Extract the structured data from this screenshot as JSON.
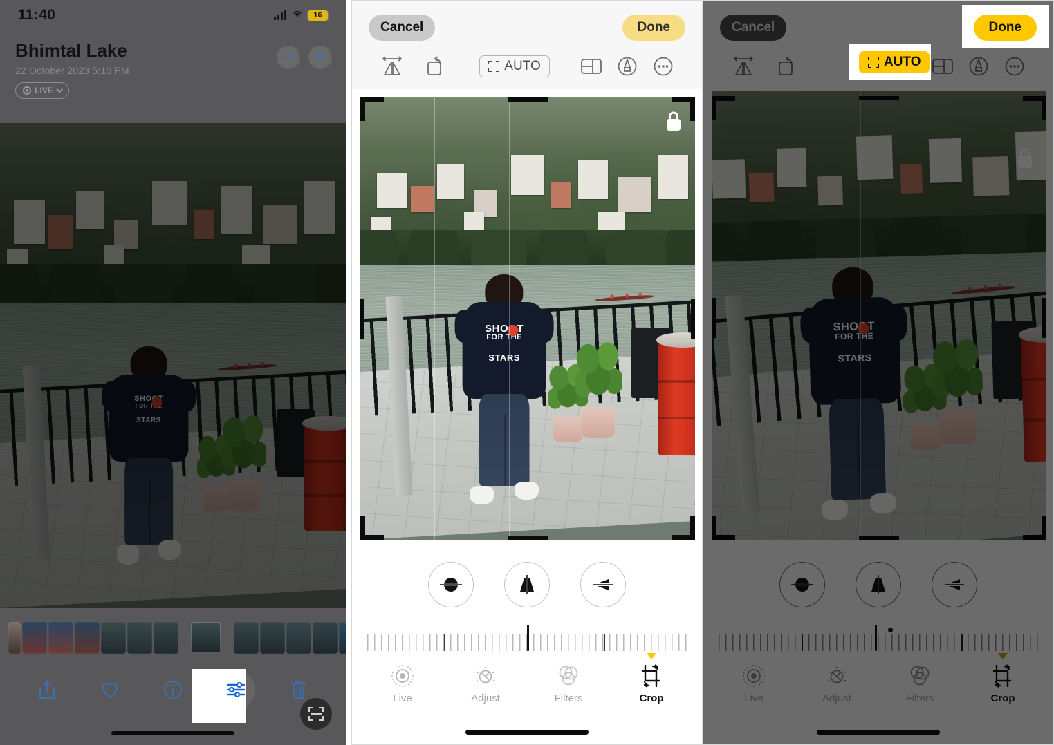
{
  "panel1": {
    "status_bar": {
      "time": "11:40",
      "battery_level": "16",
      "cellular_icon": "cellular-bars-icon",
      "wifi_icon": "wifi-icon",
      "battery_color": "#e0b714"
    },
    "photo_title": "Bhimtal Lake",
    "photo_meta": "22 October 2023  5:10 PM",
    "live_badge": {
      "label": "LIVE",
      "icon": "live-photo-icon",
      "chevron": "chevron-down-icon"
    },
    "header_buttons": [
      {
        "name": "more-options-button",
        "icon": "ellipsis-icon"
      },
      {
        "name": "close-button",
        "icon": "close-icon"
      }
    ],
    "scan_button_icon": "live-text-scan-icon",
    "toolbar": [
      {
        "label": "share",
        "icon": "share-icon",
        "highlighted": false
      },
      {
        "label": "favorite",
        "icon": "heart-icon",
        "highlighted": false
      },
      {
        "label": "info",
        "icon": "info-icon",
        "highlighted": false
      },
      {
        "label": "edit",
        "icon": "adjust-sliders-icon",
        "highlighted": true
      },
      {
        "label": "delete",
        "icon": "trash-icon",
        "highlighted": false
      }
    ],
    "accent_color": "#3f6ea8"
  },
  "panel2": {
    "cancel_label": "Cancel",
    "done_label": "Done",
    "tools": [
      {
        "name": "flip-horizontal-icon",
        "label": "Flip"
      },
      {
        "name": "rotate-icon",
        "label": "Rotate"
      },
      {
        "name": "auto-icon",
        "label": "AUTO",
        "active": false
      },
      {
        "name": "aspect-ratio-icon",
        "label": "Aspect Ratio"
      },
      {
        "name": "markup-pen-icon",
        "label": "Markup"
      },
      {
        "name": "more-ellipsis-icon",
        "label": "More"
      }
    ],
    "auto_label": "AUTO",
    "lock_icon": "aspect-lock-icon",
    "geometry_controls": [
      {
        "name": "straighten-icon",
        "label": "Straighten"
      },
      {
        "name": "vertical-perspective-icon",
        "label": "Vertical"
      },
      {
        "name": "horizontal-perspective-icon",
        "label": "Horizontal"
      }
    ],
    "ruler": {
      "needle_percent": 50,
      "major_tick_percents": [
        24,
        74
      ],
      "dot": false
    },
    "tabs": [
      {
        "label": "Live",
        "icon": "live-photo-icon",
        "active": false
      },
      {
        "label": "Adjust",
        "icon": "adjust-dial-icon",
        "active": false
      },
      {
        "label": "Filters",
        "icon": "filters-circles-icon",
        "active": false
      },
      {
        "label": "Crop",
        "icon": "crop-icon",
        "active": true
      }
    ]
  },
  "panel3": {
    "cancel_label": "Cancel",
    "done_label": "Done",
    "done_highlighted": true,
    "auto_label": "AUTO",
    "auto_active": true,
    "auto_highlighted": true,
    "lock_icon": "aspect-lock-icon",
    "tools": [
      {
        "name": "flip-horizontal-icon",
        "label": "Flip"
      },
      {
        "name": "rotate-icon",
        "label": "Rotate"
      },
      {
        "name": "auto-icon",
        "label": "AUTO",
        "active": true
      },
      {
        "name": "aspect-ratio-icon",
        "label": "Aspect Ratio"
      },
      {
        "name": "markup-pen-icon",
        "label": "Markup"
      },
      {
        "name": "more-ellipsis-icon",
        "label": "More"
      }
    ],
    "geometry_controls": [
      {
        "name": "straighten-icon",
        "label": "Straighten"
      },
      {
        "name": "vertical-perspective-icon",
        "label": "Vertical"
      },
      {
        "name": "horizontal-perspective-icon",
        "label": "Horizontal"
      }
    ],
    "ruler": {
      "needle_percent": 49,
      "major_tick_percents": [
        26,
        76
      ],
      "dot": true
    },
    "tabs": [
      {
        "label": "Live",
        "icon": "live-photo-icon",
        "active": false
      },
      {
        "label": "Adjust",
        "icon": "adjust-dial-icon",
        "active": false
      },
      {
        "label": "Filters",
        "icon": "filters-circles-icon",
        "active": false
      },
      {
        "label": "Crop",
        "icon": "crop-icon",
        "active": true
      }
    ]
  },
  "photo": {
    "shirt_text_line1": "SHOOT",
    "shirt_text_line2": "FOR THE",
    "shirt_text_line3": "STARS"
  },
  "colors": {
    "accent_yellow": "#ffc700",
    "done_yellow": "#f6dd84",
    "ios_blue": "#3f6ea8",
    "highlight_box": "#ffffff"
  }
}
